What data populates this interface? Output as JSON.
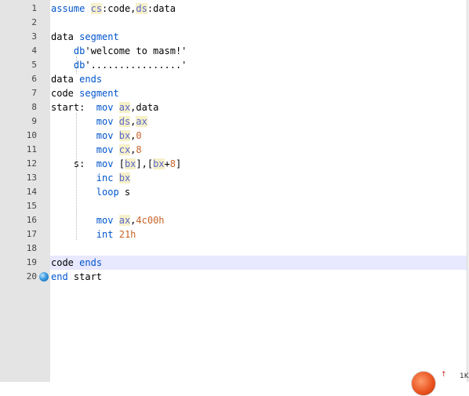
{
  "editor": {
    "lines": [
      {
        "num": "1",
        "tokens": [
          {
            "t": "assume",
            "c": "kw"
          },
          {
            "t": " ",
            "c": ""
          },
          {
            "t": "cs",
            "c": "reg"
          },
          {
            "t": ":code,",
            "c": ""
          },
          {
            "t": "ds",
            "c": "reg"
          },
          {
            "t": ":data",
            "c": ""
          }
        ]
      },
      {
        "num": "2",
        "tokens": []
      },
      {
        "num": "3",
        "tokens": [
          {
            "t": "data",
            "c": ""
          },
          {
            "t": " ",
            "c": ""
          },
          {
            "t": "segment",
            "c": "kw"
          }
        ]
      },
      {
        "num": "4",
        "tokens": [
          {
            "t": "    ",
            "c": ""
          },
          {
            "t": "db",
            "c": "kw"
          },
          {
            "t": "'welcome to masm!'",
            "c": "str"
          }
        ]
      },
      {
        "num": "5",
        "tokens": [
          {
            "t": "    ",
            "c": ""
          },
          {
            "t": "db",
            "c": "kw"
          },
          {
            "t": "'................'",
            "c": "str"
          }
        ]
      },
      {
        "num": "6",
        "tokens": [
          {
            "t": "data",
            "c": ""
          },
          {
            "t": " ",
            "c": ""
          },
          {
            "t": "ends",
            "c": "kw"
          }
        ]
      },
      {
        "num": "7",
        "tokens": [
          {
            "t": "code",
            "c": ""
          },
          {
            "t": " ",
            "c": ""
          },
          {
            "t": "segment",
            "c": "kw"
          }
        ]
      },
      {
        "num": "8",
        "tokens": [
          {
            "t": "start:  ",
            "c": ""
          },
          {
            "t": "mov",
            "c": "kw"
          },
          {
            "t": " ",
            "c": ""
          },
          {
            "t": "ax",
            "c": "reg"
          },
          {
            "t": ",data",
            "c": ""
          }
        ]
      },
      {
        "num": "9",
        "tokens": [
          {
            "t": "        ",
            "c": ""
          },
          {
            "t": "mov",
            "c": "kw"
          },
          {
            "t": " ",
            "c": ""
          },
          {
            "t": "ds",
            "c": "reg"
          },
          {
            "t": ",",
            "c": ""
          },
          {
            "t": "ax",
            "c": "reg"
          }
        ]
      },
      {
        "num": "10",
        "tokens": [
          {
            "t": "        ",
            "c": ""
          },
          {
            "t": "mov",
            "c": "kw"
          },
          {
            "t": " ",
            "c": ""
          },
          {
            "t": "bx",
            "c": "reg"
          },
          {
            "t": ",",
            "c": ""
          },
          {
            "t": "0",
            "c": "num"
          }
        ]
      },
      {
        "num": "11",
        "tokens": [
          {
            "t": "        ",
            "c": ""
          },
          {
            "t": "mov",
            "c": "kw"
          },
          {
            "t": " ",
            "c": ""
          },
          {
            "t": "cx",
            "c": "reg"
          },
          {
            "t": ",",
            "c": ""
          },
          {
            "t": "8",
            "c": "num"
          }
        ]
      },
      {
        "num": "12",
        "tokens": [
          {
            "t": "    s:  ",
            "c": ""
          },
          {
            "t": "mov",
            "c": "kw"
          },
          {
            "t": " [",
            "c": ""
          },
          {
            "t": "bx",
            "c": "reg"
          },
          {
            "t": "],[",
            "c": ""
          },
          {
            "t": "bx",
            "c": "reg"
          },
          {
            "t": "+",
            "c": ""
          },
          {
            "t": "8",
            "c": "num"
          },
          {
            "t": "]",
            "c": ""
          }
        ]
      },
      {
        "num": "13",
        "tokens": [
          {
            "t": "        ",
            "c": ""
          },
          {
            "t": "inc",
            "c": "kw"
          },
          {
            "t": " ",
            "c": ""
          },
          {
            "t": "bx",
            "c": "reg"
          }
        ]
      },
      {
        "num": "14",
        "tokens": [
          {
            "t": "        ",
            "c": ""
          },
          {
            "t": "loop",
            "c": "kw"
          },
          {
            "t": " s",
            "c": ""
          }
        ]
      },
      {
        "num": "15",
        "tokens": []
      },
      {
        "num": "16",
        "tokens": [
          {
            "t": "        ",
            "c": ""
          },
          {
            "t": "mov",
            "c": "kw"
          },
          {
            "t": " ",
            "c": ""
          },
          {
            "t": "ax",
            "c": "reg"
          },
          {
            "t": ",",
            "c": ""
          },
          {
            "t": "4c00h",
            "c": "num"
          }
        ]
      },
      {
        "num": "17",
        "tokens": [
          {
            "t": "        ",
            "c": ""
          },
          {
            "t": "int",
            "c": "kw"
          },
          {
            "t": " ",
            "c": ""
          },
          {
            "t": "21h",
            "c": "num"
          }
        ]
      },
      {
        "num": "18",
        "tokens": []
      },
      {
        "num": "19",
        "tokens": [
          {
            "t": "code",
            "c": ""
          },
          {
            "t": " ",
            "c": ""
          },
          {
            "t": "ends",
            "c": "kw"
          }
        ]
      },
      {
        "num": "20",
        "tokens": [
          {
            "t": "end",
            "c": "kw"
          },
          {
            "t": " start",
            "c": ""
          }
        ]
      }
    ],
    "current_line": "19",
    "bookmark_line": "20"
  },
  "colors": {
    "keyword": "#0055cc",
    "register": "#5a67cc",
    "number": "#c86428",
    "gutter": "#e4e4e4",
    "current_line": "#e8e8ff"
  },
  "widget": {
    "arrow": "↑",
    "text": "1K"
  }
}
